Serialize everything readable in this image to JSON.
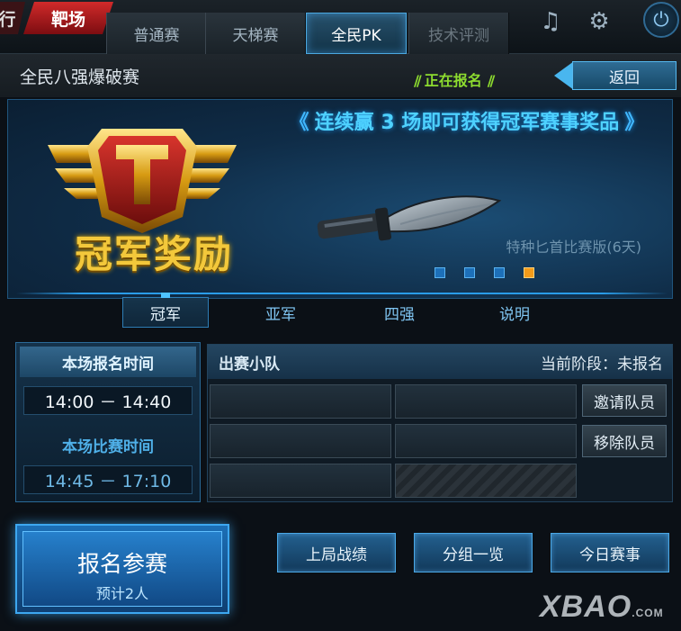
{
  "topbar": {
    "cut_tab": "行",
    "range_tab": "靶场",
    "tabs": [
      {
        "label": "普通赛"
      },
      {
        "label": "天梯赛"
      },
      {
        "label": "全民PK"
      },
      {
        "label": "技术评测"
      }
    ],
    "icons": [
      "music-icon",
      "gear-icon",
      "power-icon"
    ]
  },
  "title_row": {
    "title": "全民八强爆破赛",
    "status": "正在报名",
    "back_label": "返回"
  },
  "banner": {
    "emblem_text": "冠军奖励",
    "promo": "连续赢 3 场即可获得冠军赛事奖品",
    "item_caption": "特种匕首比赛版(6天)",
    "page_dots": 4,
    "active_dot": 4,
    "tabs": [
      {
        "label": "冠军"
      },
      {
        "label": "亚军"
      },
      {
        "label": "四强"
      },
      {
        "label": "说明"
      }
    ]
  },
  "time_panel": {
    "signup_head": "本场报名时间",
    "signup_time": "14:00 － 14:40",
    "match_head": "本场比赛时间",
    "match_time": "14:45 － 17:10"
  },
  "team_panel": {
    "title": "出赛小队",
    "stage": "当前阶段：未报名",
    "invite_label": "邀请队员",
    "remove_label": "移除队员"
  },
  "bottom": {
    "signup_title": "报名参赛",
    "signup_sub": "预计2人",
    "buttons": [
      {
        "label": "上局战绩"
      },
      {
        "label": "分组一览"
      },
      {
        "label": "今日赛事"
      }
    ]
  },
  "watermark": {
    "text": "XBAO",
    "suffix": ".COM"
  },
  "colors": {
    "accent_blue": "#4aa8e0",
    "status_green": "#8ddc2f",
    "gold": "#f3c83b",
    "active_dot": "#f39b1a"
  }
}
